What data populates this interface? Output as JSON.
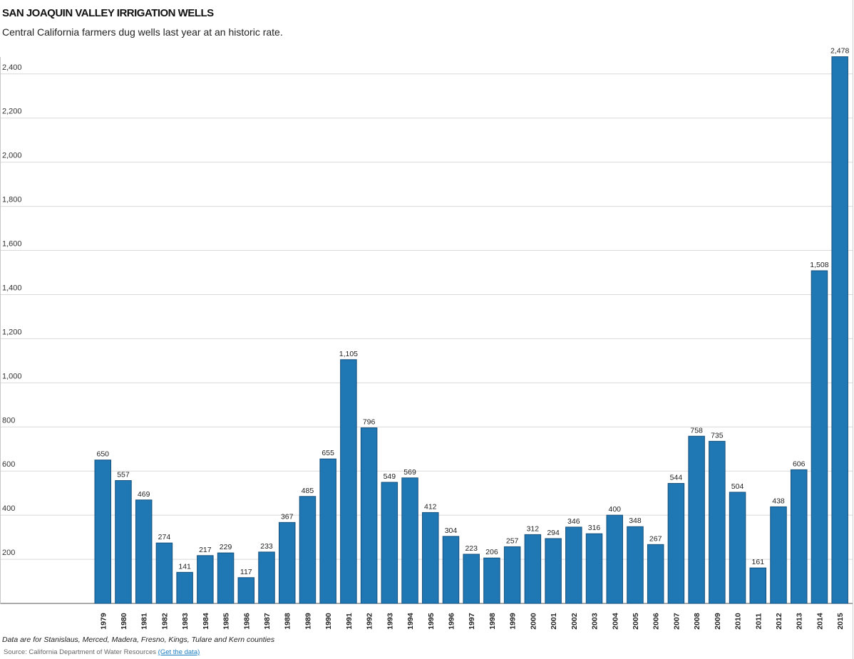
{
  "chart_data": {
    "type": "bar",
    "title": "SAN JOAQUIN VALLEY IRRIGATION WELLS",
    "subtitle": "Central California farmers dug wells last year at an historic rate.",
    "categories": [
      "1979",
      "1980",
      "1981",
      "1982",
      "1983",
      "1984",
      "1985",
      "1986",
      "1987",
      "1988",
      "1989",
      "1990",
      "1991",
      "1992",
      "1993",
      "1994",
      "1995",
      "1996",
      "1997",
      "1998",
      "1999",
      "2000",
      "2001",
      "2002",
      "2003",
      "2004",
      "2005",
      "2006",
      "2007",
      "2008",
      "2009",
      "2010",
      "2011",
      "2012",
      "2013",
      "2014",
      "2015"
    ],
    "values": [
      650,
      557,
      469,
      274,
      141,
      217,
      229,
      117,
      233,
      367,
      485,
      655,
      1105,
      796,
      549,
      569,
      412,
      304,
      223,
      206,
      257,
      312,
      294,
      346,
      316,
      400,
      348,
      267,
      544,
      758,
      735,
      504,
      161,
      438,
      606,
      1508,
      2478
    ],
    "value_labels": [
      "650",
      "557",
      "469",
      "274",
      "141",
      "217",
      "229",
      "117",
      "233",
      "367",
      "485",
      "655",
      "1,105",
      "796",
      "549",
      "569",
      "412",
      "304",
      "223",
      "206",
      "257",
      "312",
      "294",
      "346",
      "316",
      "400",
      "348",
      "267",
      "544",
      "758",
      "735",
      "504",
      "161",
      "438",
      "606",
      "1,508",
      "2,478"
    ],
    "yticks": [
      200,
      400,
      600,
      800,
      1000,
      1200,
      1400,
      1600,
      1800,
      2000,
      2200,
      2400
    ],
    "ytick_labels": [
      "200",
      "400",
      "600",
      "800",
      "1,000",
      "1,200",
      "1,400",
      "1,600",
      "1,800",
      "2,000",
      "2,200",
      "2,400"
    ],
    "ylim": [
      0,
      2480
    ],
    "xlabel": "",
    "ylabel": "",
    "grid": true,
    "bar_color": "#1f77b4",
    "note": "Data are for Stanislaus, Merced, Madera, Fresno, Kings, Tulare and Kern counties",
    "source": "Source: California Department of Water Resources",
    "source_link": "(Get the data)"
  }
}
